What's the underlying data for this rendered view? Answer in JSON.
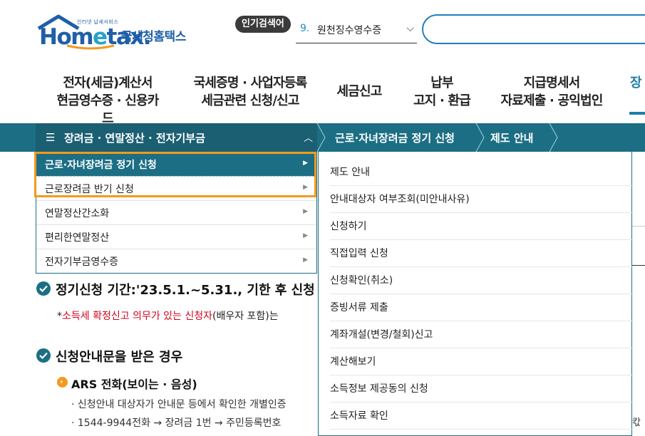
{
  "header": {
    "logo_tagline": "인터넷 납세서비스",
    "logo_word_pre": "Hom",
    "logo_word_e": "e",
    "logo_word_post": "tax.",
    "logo_korean": "국세청홈택스",
    "popular_badge": "인기검색어",
    "popular_number": "9.",
    "popular_term": "원천징수영수증",
    "search_value": ""
  },
  "gnb": {
    "items": [
      {
        "line1": "전자(세금)계산서",
        "line2": "현금영수증 · 신용카드"
      },
      {
        "line1": "국세증명 · 사업자등록",
        "line2": "세금관련 신청/신고"
      },
      {
        "line1": "세금신고",
        "line2": ""
      },
      {
        "line1": "납부",
        "line2": "고지 · 환급"
      },
      {
        "line1": "지급명세서",
        "line2": "자료제출 · 공익법인"
      },
      {
        "line1": "장",
        "line2": ""
      }
    ]
  },
  "breadcrumb": {
    "main": "장려금 · 연말정산 · 전자기부금",
    "second": "근로·자녀장려금 정기 신청",
    "third": "제도 안내"
  },
  "dropdown": {
    "items": [
      {
        "label": "근로·자녀장려금 정기 신청"
      },
      {
        "label": "근로장려금 반기 신청"
      },
      {
        "label": "연말정산간소화"
      },
      {
        "label": "편리한연말정산"
      },
      {
        "label": "전자기부금영수증"
      }
    ]
  },
  "submenu": {
    "items": [
      {
        "label": "제도 안내"
      },
      {
        "label": "안내대상자 여부조회(미안내사유)"
      },
      {
        "label": "신청하기"
      },
      {
        "label": "직접입력 신청"
      },
      {
        "label": "신청확인(취소)"
      },
      {
        "label": "증빙서류 제출"
      },
      {
        "label": "계좌개설(변경/철회)신고"
      },
      {
        "label": "계산해보기"
      },
      {
        "label": "소득정보 제공동의 신청"
      },
      {
        "label": "소득자료 확인"
      }
    ]
  },
  "content": {
    "period_title": "정기신청 기간:'23.5.1.~5.31., 기한 후 신청",
    "note_prefix": "*",
    "note_red": "소득세 확정신고 의무가 있는 신청자",
    "note_rest": "(배우자 포함)는",
    "guide_title": "신청안내문을 받은 경우",
    "ars_badge": "›",
    "ars_title": "ARS 전화(보이는 · 음성)",
    "bullet1": "· 신청안내 대상자가 안내문 등에서 확인한 개별인증",
    "bullet2": "· 1544-9944전화 → 장려금 1번 → 주민등록번호",
    "right_cut": "칷"
  },
  "colors": {
    "brand_blue": "#1f5fa8",
    "teal": "#1c6e84",
    "highlight_orange": "#f39a1e",
    "note_red": "#d0021b"
  }
}
